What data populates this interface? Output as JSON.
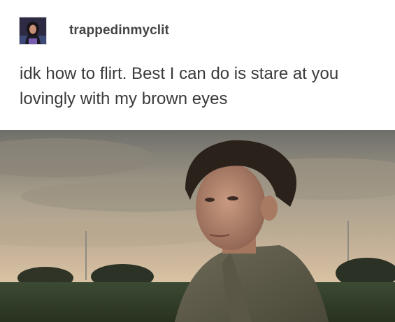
{
  "post": {
    "username": "trappedinmyclit",
    "text": "idk how to flirt. Best I can do is stare at you lovingly with my brown eyes"
  },
  "icons": {
    "avatar": "user-avatar-photo"
  },
  "colors": {
    "username": "#444444",
    "body_text": "#3a3a3a",
    "background": "#ffffff"
  }
}
